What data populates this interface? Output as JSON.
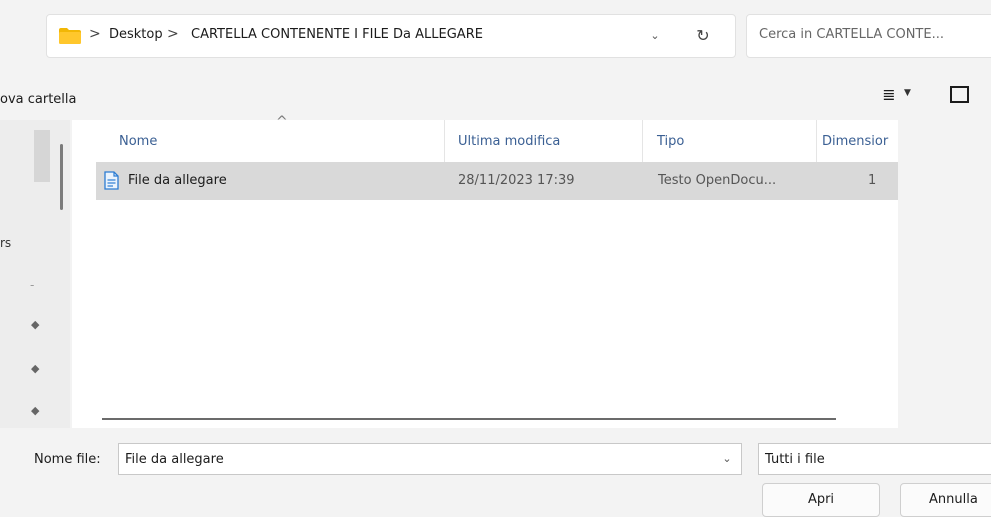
{
  "address": {
    "folder_icon": "folder-icon",
    "separator": ">",
    "path": [
      "Desktop",
      "CARTELLA CONTENENTE I FILE Da ALLEGARE"
    ],
    "dropdown_glyph": "⌄",
    "refresh_glyph": "↻"
  },
  "search": {
    "placeholder": "Cerca in CARTELLA CONTE..."
  },
  "toolbar": {
    "new_folder_label": "ova cartella",
    "view_icon": "list-view-icon",
    "preview_icon": "preview-pane-icon"
  },
  "nav": {
    "partial_label_1": "rs",
    "partial_label_2": "-"
  },
  "columns": {
    "name": "Nome",
    "modified": "Ultima modifica",
    "type": "Tipo",
    "size": "Dimensior"
  },
  "files": [
    {
      "name": "File da allegare",
      "modified": "28/11/2023 17:39",
      "type": "Testo OpenDocu...",
      "size": "1",
      "selected": true,
      "icon": "document-icon"
    }
  ],
  "footer": {
    "filename_label": "Nome file:",
    "filename_value": "File da allegare",
    "filter_value": "Tutti i file",
    "open_button": "Apri",
    "cancel_button": "Annulla"
  },
  "colors": {
    "window_bg": "#f3f3f3",
    "list_bg": "#ffffff",
    "selection": "#d9d9d9",
    "header_text": "#3a5f93",
    "folder": "#f2b705"
  }
}
